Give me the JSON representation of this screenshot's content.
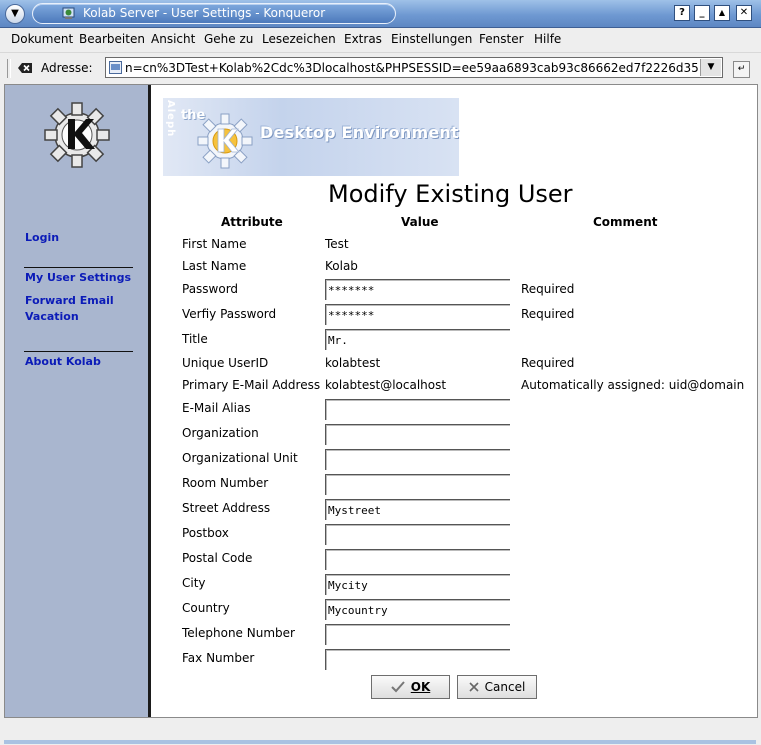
{
  "window": {
    "title": "Kolab Server - User Settings - Konqueror",
    "buttons": {
      "help": "?",
      "minimize": "_",
      "maximize": "▲",
      "close": "✕"
    }
  },
  "menubar": {
    "items": [
      "Dokument",
      "Bearbeiten",
      "Ansicht",
      "Gehe zu",
      "Lesezeichen",
      "Extras",
      "Einstellungen",
      "Fenster",
      "Hilfe"
    ]
  },
  "addressbar": {
    "label": "Adresse:",
    "url": "n=cn%3DTest+Kolab%2Cdc%3Dlocalhost&PHPSESSID=ee59aa6893cab93c86662ed7f2226d35"
  },
  "sidebar": {
    "login": "Login",
    "my_user_settings": "My User Settings",
    "forward_email": "Forward Email",
    "vacation": "Vacation",
    "about": "About Kolab"
  },
  "banner": {
    "aleph": "Aleph",
    "the": "the",
    "title": "Desktop Environment"
  },
  "page": {
    "title": "Modify Existing User",
    "headers": {
      "attribute": "Attribute",
      "value": "Value",
      "comment": "Comment"
    }
  },
  "rows": {
    "first_name": {
      "label": "First Name",
      "value": "Test"
    },
    "last_name": {
      "label": "Last Name",
      "value": "Kolab"
    },
    "password": {
      "label": "Password",
      "value": "*******",
      "comment": "Required"
    },
    "verify_password": {
      "label": "Verfiy Password",
      "value": "*******",
      "comment": "Required"
    },
    "title": {
      "label": "Title",
      "value": "Mr."
    },
    "uid": {
      "label": "Unique UserID",
      "value": "kolabtest",
      "comment": "Required"
    },
    "primary_email": {
      "label": "Primary E-Mail Address",
      "value": "kolabtest@localhost",
      "comment": "Automatically assigned: uid@domain"
    },
    "email_alias": {
      "label": "E-Mail Alias",
      "value": ""
    },
    "organization": {
      "label": "Organization",
      "value": ""
    },
    "org_unit": {
      "label": "Organizational Unit",
      "value": ""
    },
    "room": {
      "label": "Room Number",
      "value": ""
    },
    "street": {
      "label": "Street Address",
      "value": "Mystreet"
    },
    "postbox": {
      "label": "Postbox",
      "value": ""
    },
    "postal_code": {
      "label": "Postal Code",
      "value": ""
    },
    "city": {
      "label": "City",
      "value": "Mycity"
    },
    "country": {
      "label": "Country",
      "value": "Mycountry"
    },
    "telephone": {
      "label": "Telephone Number",
      "value": ""
    },
    "fax": {
      "label": "Fax Number",
      "value": ""
    }
  },
  "buttons": {
    "ok": "OK",
    "cancel": "Cancel"
  },
  "colors": {
    "sidebar_bg": "#a9b6cf",
    "link": "#0b1bb8",
    "titlebar": "#6f99d2"
  }
}
